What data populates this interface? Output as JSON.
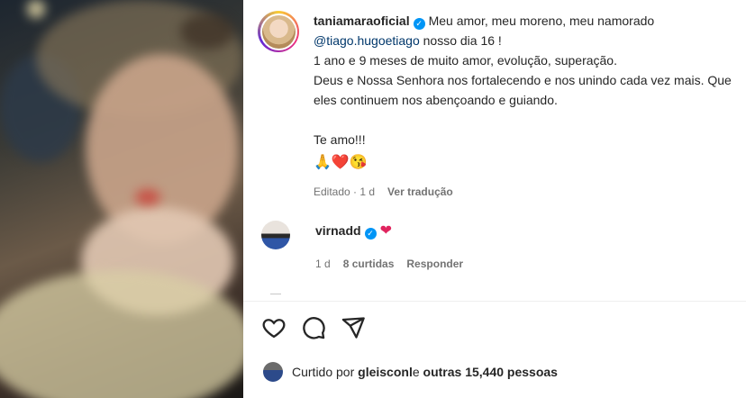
{
  "post": {
    "username": "taniamaraoficial",
    "caption_line1": "Meu amor, meu moreno, meu namorado",
    "mention": "@tiago.hugoetiago",
    "caption_line2_rest": " nosso dia 16 !",
    "caption_line3": "1 ano e 9 meses de muito amor, evolução, superação.",
    "caption_line4": "Deus e Nossa Senhora nos fortalecendo e nos unindo cada vez mais. Que eles continuem nos abençoando e guiando.",
    "caption_line5": "Te amo!!!",
    "emojis": "🙏❤️😘",
    "edited": "Editado · 1 d",
    "see_translation": "Ver tradução"
  },
  "comment": {
    "username": "virnadd",
    "emoji": "❤",
    "time": "1 d",
    "likes": "8 curtidas",
    "reply": "Responder"
  },
  "likes": {
    "prefix": "Curtido por ",
    "user": "gleisconl",
    "middle": " e ",
    "others": "outras 15,440 pessoas"
  },
  "icons": [
    "heart-icon",
    "comment-icon",
    "share-icon"
  ],
  "colors": {
    "accent": "#0095f6",
    "mention": "#00376b",
    "heart": "#e0245e"
  }
}
